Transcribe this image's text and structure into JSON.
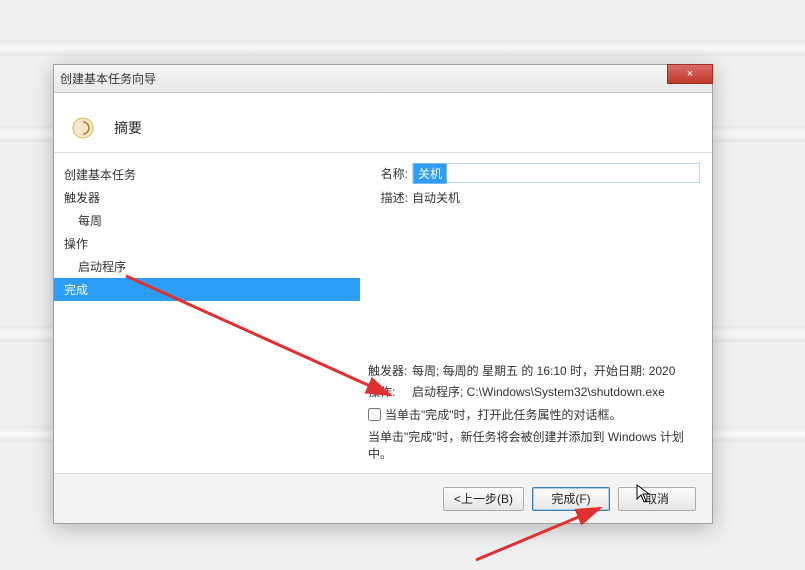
{
  "window": {
    "title": "创建基本任务向导",
    "close_label": "×"
  },
  "header": {
    "heading": "摘要"
  },
  "sidebar": {
    "items": [
      {
        "label": "创建基本任务"
      },
      {
        "label": "触发器"
      },
      {
        "label": "每周"
      },
      {
        "label": "操作"
      },
      {
        "label": "启动程序"
      },
      {
        "label": "完成"
      }
    ]
  },
  "form": {
    "name_label": "名称:",
    "name_value": "关机",
    "desc_label": "描述:",
    "desc_value": "自动关机"
  },
  "summary": {
    "trigger_label": "触发器:",
    "trigger_value": "每周; 每周的 星期五 的 16:10 时，开始日期: 2020",
    "action_label": "操作:",
    "action_value": "启动程序; C:\\Windows\\System32\\shutdown.exe",
    "checkbox_label": "当单击\"完成\"时，打开此任务属性的对话框。",
    "info_text": "当单击\"完成\"时，新任务将会被创建并添加到 Windows 计划中。"
  },
  "footer": {
    "back_label": "<上一步(B)",
    "finish_label": "完成(F)",
    "cancel_label": "取消"
  }
}
